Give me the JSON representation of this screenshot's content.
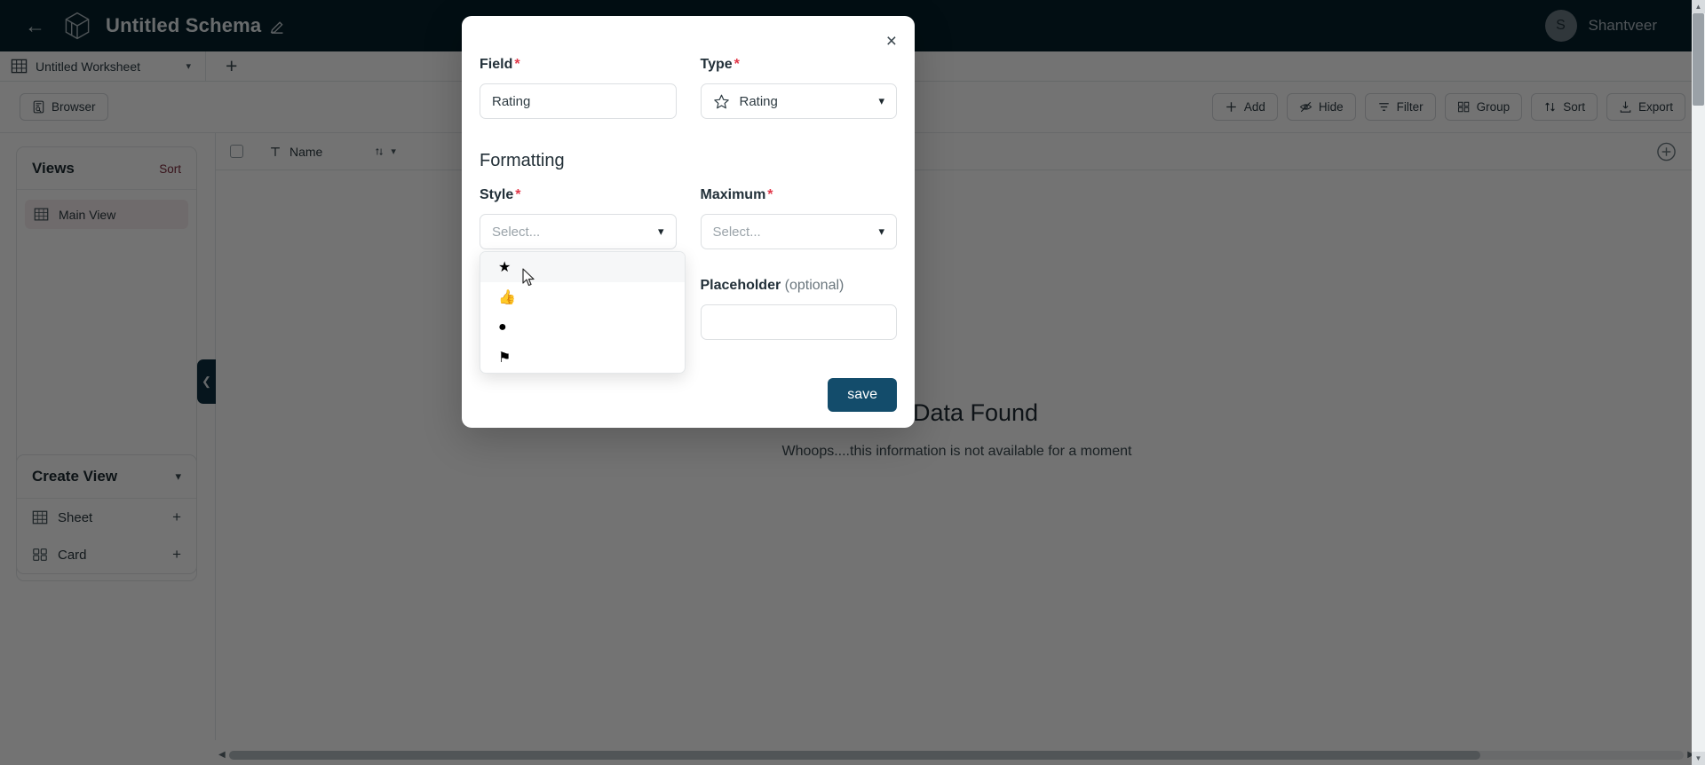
{
  "topbar": {
    "back_icon": "back-arrow-icon",
    "logo_icon": "cube-logo-icon",
    "schema_title": "Untitled Schema",
    "edit_icon": "pencil-edit-icon",
    "avatar_initial": "S",
    "user_name": "Shantveer",
    "bg_color": "#061f2b"
  },
  "tabbar": {
    "sheet_icon": "grid-table-icon",
    "worksheet_name": "Untitled Worksheet",
    "caret_icon": "chevron-down-icon",
    "add_tab_label": "+"
  },
  "toolbar": {
    "browser_label": "Browser",
    "browser_icon": "browser-panel-icon",
    "buttons": [
      {
        "label": "Add",
        "icon": "plus-icon"
      },
      {
        "label": "Hide",
        "icon": "eye-off-icon"
      },
      {
        "label": "Filter",
        "icon": "filter-icon"
      },
      {
        "label": "Group",
        "icon": "group-icon"
      },
      {
        "label": "Sort",
        "icon": "sort-icon"
      },
      {
        "label": "Export",
        "icon": "export-download-icon"
      }
    ]
  },
  "views_panel": {
    "title": "Views",
    "sort_label": "Sort",
    "sort_color": "#7c2b3c",
    "items": [
      {
        "label": "Main View",
        "icon": "grid-table-icon"
      }
    ]
  },
  "create_panel": {
    "title": "Create View",
    "collapse_icon": "chevron-down-icon",
    "rows": [
      {
        "label": "Sheet",
        "icon": "grid-table-icon",
        "action": "+"
      },
      {
        "label": "Card",
        "icon": "card-grid-icon",
        "action": "+"
      }
    ]
  },
  "grid": {
    "checkbox_icon": "checkbox-icon",
    "columns": [
      {
        "label": "Name",
        "type_icon": "text-type-icon",
        "sort_icon": "sort-arrows-icon",
        "menu_icon": "chevron-down-icon"
      }
    ],
    "add_column_icon": "add-column-plus-icon",
    "empty_title": "No Data Found",
    "empty_subtitle": "Whoops....this information is not available for a moment"
  },
  "collapse_handle": {
    "icon": "chevron-left-icon"
  },
  "modal": {
    "close_icon": "close-x-icon",
    "field": {
      "label": "Field",
      "required": "*",
      "value": "Rating",
      "placeholder": ""
    },
    "type": {
      "label": "Type",
      "required": "*",
      "value": "Rating",
      "icon": "star-outline-icon",
      "caret_icon": "chevron-down-icon"
    },
    "formatting_title": "Formatting",
    "style": {
      "label": "Style",
      "required": "*",
      "value": "",
      "placeholder": "Select...",
      "caret_icon": "chevron-down-icon",
      "options": [
        {
          "icon": "star-filled-icon",
          "glyph": "★",
          "name": "star"
        },
        {
          "icon": "thumbs-up-icon",
          "glyph": "👍",
          "name": "thumbs-up"
        },
        {
          "icon": "circle-filled-icon",
          "glyph": "●",
          "name": "circle"
        },
        {
          "icon": "flag-filled-icon",
          "glyph": "⚑",
          "name": "flag"
        }
      ]
    },
    "maximum": {
      "label": "Maximum",
      "required": "*",
      "value": "",
      "placeholder": "Select...",
      "caret_icon": "chevron-down-icon"
    },
    "placeholder_field": {
      "label": "Placeholder",
      "optional": "(optional)",
      "value": "",
      "placeholder": ""
    },
    "save_label": "save",
    "save_color": "#134c6b"
  },
  "scrollbars": {
    "vertical_up_icon": "triangle-up-icon",
    "vertical_down_icon": "triangle-down-icon",
    "horizontal_left_icon": "triangle-left-icon",
    "horizontal_right_icon": "triangle-right-icon"
  }
}
